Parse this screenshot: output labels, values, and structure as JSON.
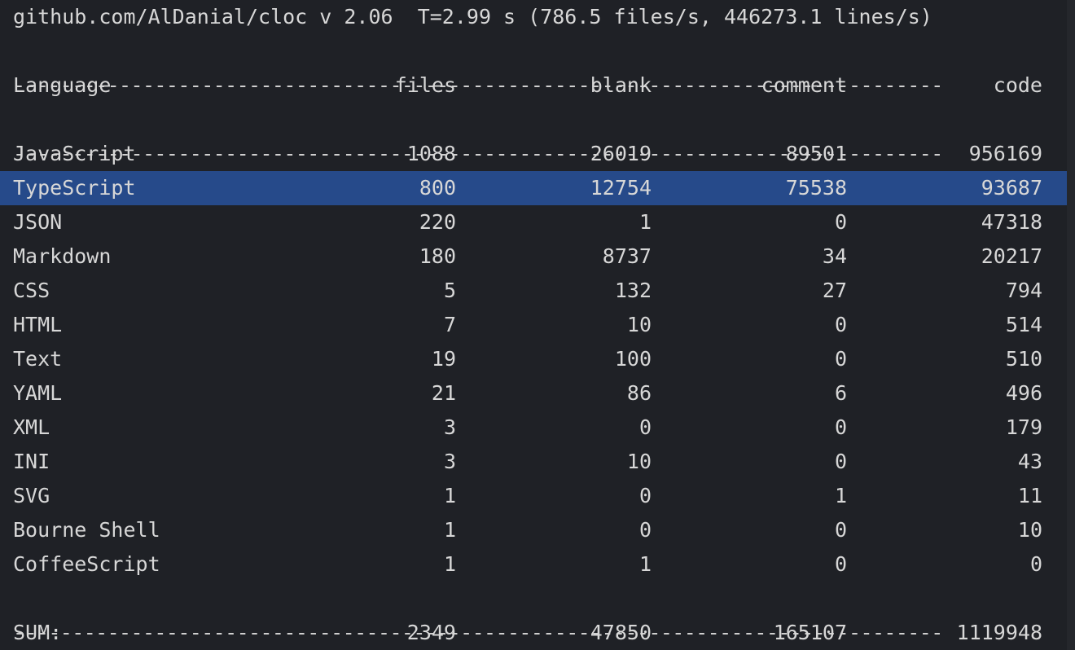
{
  "header": {
    "text": "github.com/AlDanial/cloc v 2.06  T=2.99 s (786.5 files/s, 446273.1 lines/s)"
  },
  "separator": "-------------------------------------------------------------------------------",
  "columns": {
    "language": "Language",
    "files": "files",
    "blank": "blank",
    "comment": "comment",
    "code": "code"
  },
  "rows": [
    {
      "language": "JavaScript",
      "files": "1088",
      "blank": "26019",
      "comment": "89501",
      "code": "956169"
    },
    {
      "language": "TypeScript",
      "files": "800",
      "blank": "12754",
      "comment": "75538",
      "code": "93687"
    },
    {
      "language": "JSON",
      "files": "220",
      "blank": "1",
      "comment": "0",
      "code": "47318"
    },
    {
      "language": "Markdown",
      "files": "180",
      "blank": "8737",
      "comment": "34",
      "code": "20217"
    },
    {
      "language": "CSS",
      "files": "5",
      "blank": "132",
      "comment": "27",
      "code": "794"
    },
    {
      "language": "HTML",
      "files": "7",
      "blank": "10",
      "comment": "0",
      "code": "514"
    },
    {
      "language": "Text",
      "files": "19",
      "blank": "100",
      "comment": "0",
      "code": "510"
    },
    {
      "language": "YAML",
      "files": "21",
      "blank": "86",
      "comment": "6",
      "code": "496"
    },
    {
      "language": "XML",
      "files": "3",
      "blank": "0",
      "comment": "0",
      "code": "179"
    },
    {
      "language": "INI",
      "files": "3",
      "blank": "10",
      "comment": "0",
      "code": "43"
    },
    {
      "language": "SVG",
      "files": "1",
      "blank": "0",
      "comment": "1",
      "code": "11"
    },
    {
      "language": "Bourne Shell",
      "files": "1",
      "blank": "0",
      "comment": "0",
      "code": "10"
    },
    {
      "language": "CoffeeScript",
      "files": "1",
      "blank": "1",
      "comment": "0",
      "code": "0"
    }
  ],
  "sum": {
    "language": "SUM:",
    "files": "2349",
    "blank": "47850",
    "comment": "165107",
    "code": "1119948"
  },
  "colors": {
    "background": "#1f2126",
    "text": "#d7d7d7",
    "selection": "#264a8a"
  }
}
